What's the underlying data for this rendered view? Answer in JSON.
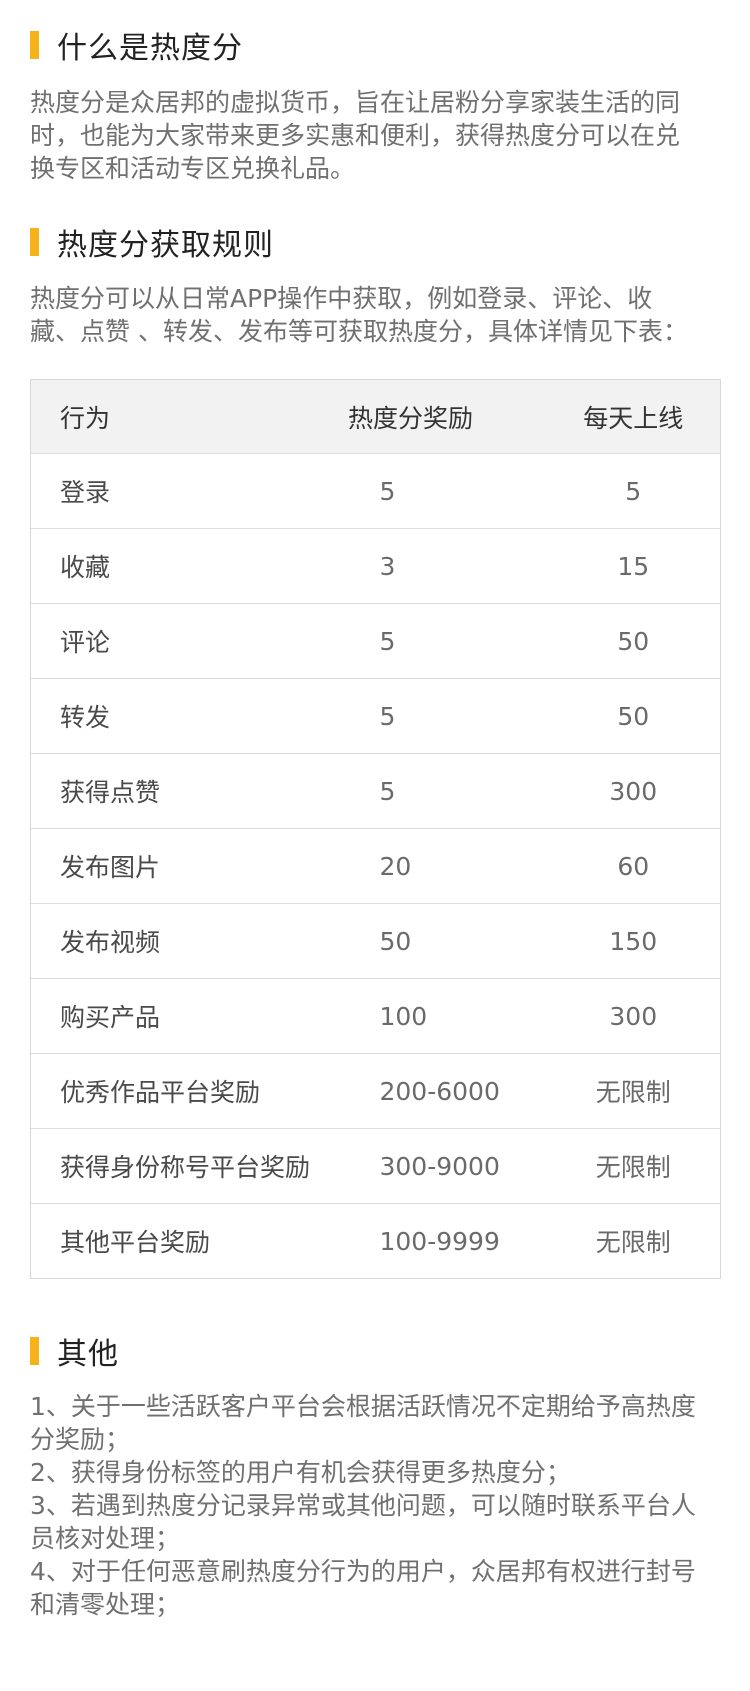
{
  "section1": {
    "title": "什么是热度分",
    "lines": [
      "热度分是众居邦的虚拟货币，旨在让居粉分享家装生活的同",
      "时，也能为大家带来更多实惠和便利，获得热度分可以在兑",
      "换专区和活动专区兑换礼品。"
    ]
  },
  "section2": {
    "title": "热度分获取规则",
    "lines": [
      "热度分可以从日常APP操作中获取，例如登录、评论、收",
      "藏、点赞 、转发、发布等可获取热度分，具体详情见下表："
    ]
  },
  "table": {
    "headers": [
      "行为",
      "热度分奖励",
      "每天上线"
    ],
    "rows": [
      [
        "登录",
        "5",
        "5"
      ],
      [
        "收藏",
        "3",
        "15"
      ],
      [
        "评论",
        "5",
        "50"
      ],
      [
        "转发",
        "5",
        "50"
      ],
      [
        "获得点赞",
        "5",
        "300"
      ],
      [
        "发布图片",
        "20",
        "60"
      ],
      [
        "发布视频",
        "50",
        "150"
      ],
      [
        "购买产品",
        "100",
        "300"
      ],
      [
        "优秀作品平台奖励",
        "200-6000",
        "无限制"
      ],
      [
        "获得身份称号平台奖励",
        "300-9000",
        "无限制"
      ],
      [
        "其他平台奖励",
        "100-9999",
        "无限制"
      ]
    ]
  },
  "section3": {
    "title": "其他",
    "lines": [
      "1、关于一些活跃客户平台会根据活跃情况不定期给予高热度",
      "分奖励；",
      "2、获得身份标签的用户有机会获得更多热度分；",
      "3、若遇到热度分记录异常或其他问题，可以随时联系平台人",
      "员核对处理；",
      "4、对于任何恶意刷热度分行为的用户，众居邦有权进行封号",
      "和清零处理；"
    ]
  },
  "colors": {
    "accent_bar": "#f6b21b",
    "title_text": "#222222",
    "body_text": "#707070",
    "table_header_bg": "#f2f2f2",
    "table_border": "#d8d8d8"
  }
}
